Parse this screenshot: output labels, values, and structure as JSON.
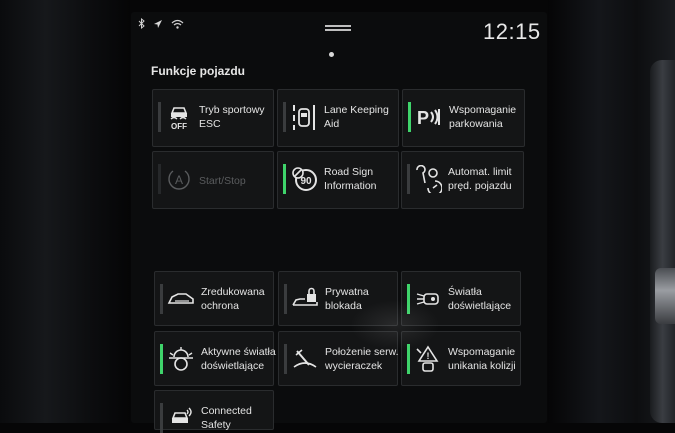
{
  "status": {
    "clock": "12:15",
    "icons": [
      "bluetooth-icon",
      "location-icon",
      "wifi-icon"
    ]
  },
  "section": {
    "title": "Funkcje pojazdu"
  },
  "tiles": [
    {
      "line1": "Tryb sportowy",
      "line2": "ESC",
      "icon": "esc-off-icon",
      "active": false,
      "enabled": true
    },
    {
      "line1": "Lane Keeping",
      "line2": "Aid",
      "icon": "lane-keeping-icon",
      "active": false,
      "enabled": true
    },
    {
      "line1": "Wspomaganie",
      "line2": "parkowania",
      "icon": "park-assist-icon",
      "active": true,
      "enabled": true
    },
    {
      "line1": "Start/Stop",
      "line2": "",
      "icon": "start-stop-icon",
      "active": false,
      "enabled": false
    },
    {
      "line1": "Road Sign",
      "line2": "Information",
      "icon": "road-sign-icon",
      "active": true,
      "enabled": true
    },
    {
      "line1": "Automat. limit",
      "line2": "pręd. pojazdu",
      "icon": "speed-limiter-icon",
      "active": false,
      "enabled": true
    },
    {
      "line1": "Zredukowana",
      "line2": "ochrona",
      "icon": "reduced-guard-icon",
      "active": false,
      "enabled": true
    },
    {
      "line1": "Prywatna",
      "line2": "blokada",
      "icon": "private-lock-icon",
      "active": false,
      "enabled": true
    },
    {
      "line1": "Światła",
      "line2": "doświetlające",
      "icon": "cornering-lights-icon",
      "active": true,
      "enabled": true
    },
    {
      "line1": "Aktywne światła",
      "line2": "doświetlające",
      "icon": "active-bending-lights-icon",
      "active": true,
      "enabled": true
    },
    {
      "line1": "Położenie serw.",
      "line2": "wycieraczek",
      "icon": "wiper-service-icon",
      "active": false,
      "enabled": true
    },
    {
      "line1": "Wspomaganie",
      "line2": "unikania kolizji",
      "icon": "collision-avoidance-icon",
      "active": true,
      "enabled": true
    },
    {
      "line1": "Connected",
      "line2": "Safety",
      "icon": "connected-safety-icon",
      "active": false,
      "enabled": true
    }
  ],
  "colors": {
    "indicator_on": "#3fd46b",
    "indicator_off": "#3a3c3e",
    "tile_bg": "#141516",
    "text": "#e4e4e4"
  }
}
